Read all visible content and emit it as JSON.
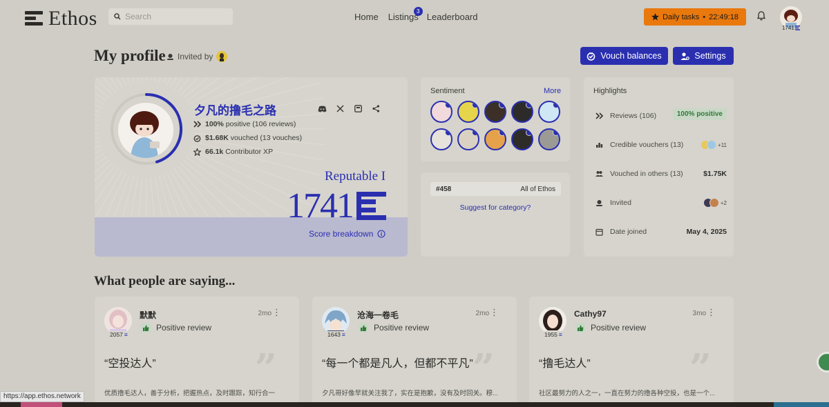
{
  "app": {
    "name": "Ethos"
  },
  "search": {
    "placeholder": "Search"
  },
  "nav": {
    "home": "Home",
    "listings": "Listings",
    "listings_badge": "3",
    "leaderboard": "Leaderboard"
  },
  "daily_tasks": {
    "label": "Daily tasks",
    "timer": "22:49:18"
  },
  "user": {
    "score": "1741"
  },
  "header": {
    "title": "My profile",
    "invited_by": "Invited by"
  },
  "actions": {
    "vouch_balances": "Vouch balances",
    "settings": "Settings"
  },
  "profile": {
    "name": "夕凡的撸毛之路",
    "positive_pct": "100%",
    "positive_text": "positive (106 reviews)",
    "vouched_amount": "$1.68K",
    "vouched_text": "vouched (13 vouches)",
    "xp": "66.1k",
    "xp_text": "Contributor XP",
    "reputation_level": "Reputable I",
    "score": "1741",
    "score_breakdown": "Score breakdown"
  },
  "sentiment": {
    "title": "Sentiment",
    "more": "More"
  },
  "rank": {
    "position": "#458",
    "scope": "All of Ethos",
    "suggest": "Suggest for category?"
  },
  "highlights": {
    "title": "Highlights",
    "reviews_label": "Reviews (106)",
    "reviews_badge": "100% positive",
    "credible_label": "Credible vouchers (13)",
    "credible_more": "+11",
    "vouched_label": "Vouched in others (13)",
    "vouched_value": "$1.75K",
    "invited_label": "Invited",
    "invited_more": "+2",
    "joined_label": "Date joined",
    "joined_value": "May 4, 2025"
  },
  "reviews_section": {
    "title": "What people are saying..."
  },
  "reviews": [
    {
      "name": "默默",
      "score": "2057",
      "time": "2mo",
      "type": "Positive review",
      "quote": "“空投达人”",
      "body": "优质撸毛达人，善于分析，把握热点，及时跟踪，知行合一"
    },
    {
      "name": "沧海一卷毛",
      "score": "1643",
      "time": "2mo",
      "type": "Positive review",
      "quote": "“每一个都是凡人，但都不平凡”",
      "body": "夕凡哥好像早就关注我了，实在是抱歉，没有及时回关。穆..."
    },
    {
      "name": "Cathy97",
      "score": "1955",
      "time": "3mo",
      "type": "Positive review",
      "quote": "“撸毛达人”",
      "body": "社区最努力的人之一，一直在努力的撸各种空投，也是一个..."
    }
  ],
  "status_bar": {
    "url": "https://app.ethos.network"
  },
  "colors": {
    "accent": "#2a2fb0",
    "daily": "#e9780d",
    "positive": "#2f7a37",
    "background": "#cfcdc6"
  }
}
